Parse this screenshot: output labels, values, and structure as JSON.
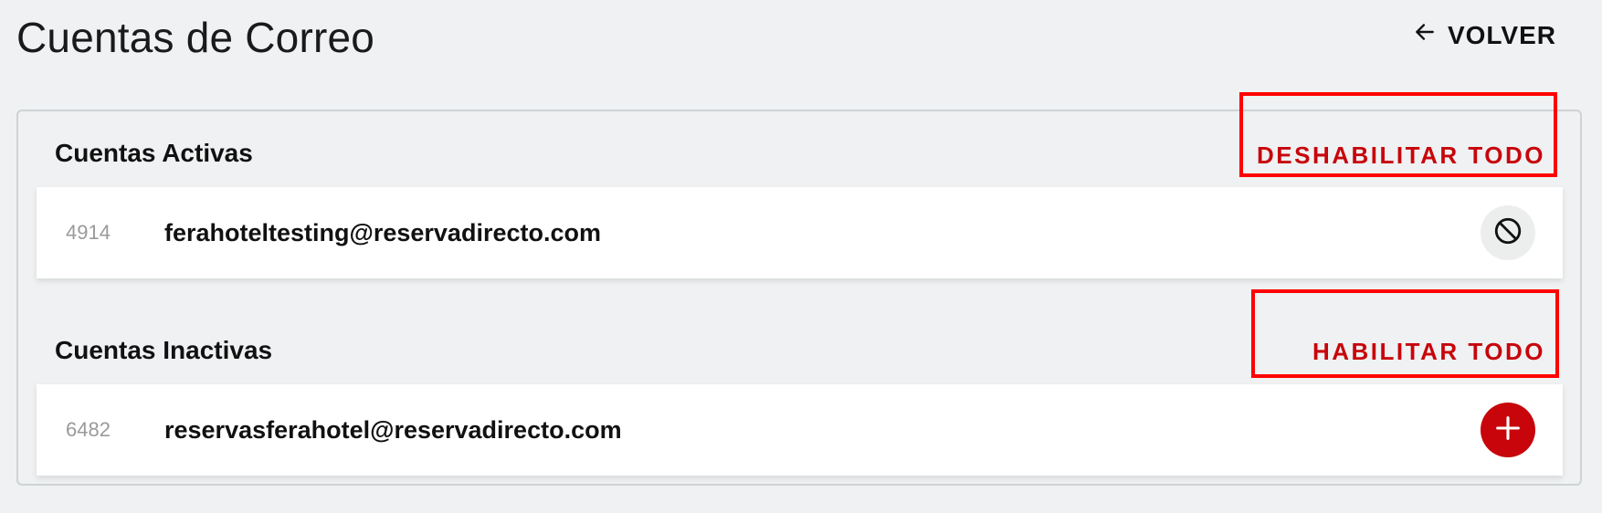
{
  "header": {
    "title": "Cuentas de Correo",
    "back_label": "VOLVER",
    "back_icon": "arrow-left-icon"
  },
  "active": {
    "title": "Cuentas Activas",
    "action_label": "DESHABILITAR TODO",
    "accounts": [
      {
        "id": "4914",
        "email": "ferahoteltesting@reservadirecto.com",
        "action_icon": "block-icon"
      }
    ]
  },
  "inactive": {
    "title": "Cuentas Inactivas",
    "action_label": "HABILITAR TODO",
    "accounts": [
      {
        "id": "6482",
        "email": "reservasferahotel@reservadirecto.com",
        "action_icon": "plus-icon"
      }
    ]
  },
  "colors": {
    "accent": "#c8050b",
    "highlight": "#ff0000",
    "background": "#eff1f2"
  }
}
